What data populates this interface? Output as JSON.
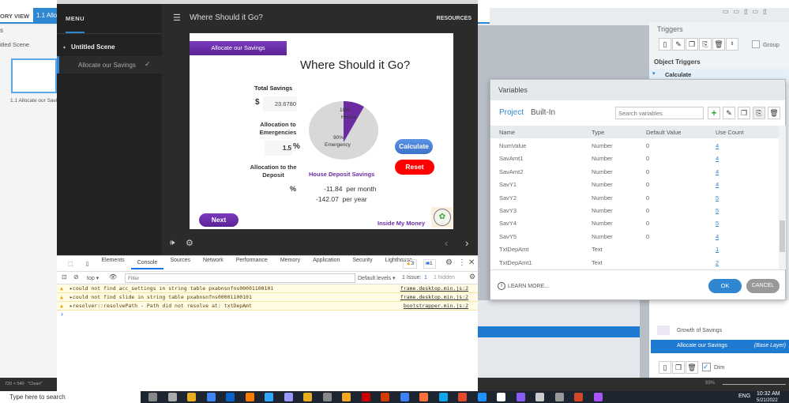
{
  "storyline": {
    "story_view": "ORY VIEW",
    "slide_tab": "1.1 Allo",
    "panel_s": "s",
    "scene_name": "itled Scene",
    "thumb_label": "1.1 Allocate our Savin",
    "dimensions": "720 × 540",
    "status_clean": "\"Clean\"",
    "triggers_title": "Triggers",
    "group_label": "Group",
    "object_triggers": "Object Triggers",
    "calculate_trigger": "Calculate",
    "layers": [
      {
        "label": "Growth of Savings"
      },
      {
        "label": "Allocate our Savings",
        "badge": "(Base Layer)"
      }
    ],
    "dim_label": "Dim",
    "zoom": "89%"
  },
  "player": {
    "menu_label": "MENU",
    "resources_label": "RESOURCES",
    "title": "Where Should it Go?",
    "scene": "Untitled Scene",
    "menu_item": "Allocate our Savings"
  },
  "slide": {
    "tag": "Allocate our Savings",
    "heading": "Where Should it Go?",
    "total_savings_label": "Total Savings",
    "currency": "$",
    "total_savings_value": "23.6780",
    "alloc_emerg_label": "Allocation to Emergencies",
    "alloc_emerg_value": "1.5",
    "pct": "%",
    "alloc_dep_label": "Allocation to the Deposit",
    "dep_pct": "%",
    "pie": {
      "house_pct": "10%",
      "house_label": "House",
      "emerg_pct": "90%",
      "emerg_label": "Emergency",
      "house_fraction": 0.1
    },
    "calculate": "Calculate",
    "reset": "Reset",
    "house_deposit_title": "House Deposit Savings",
    "per_month_value": "-11.84",
    "per_month": "per month",
    "per_year_value": "-142.07",
    "per_year": "per year",
    "next": "Next",
    "brand": "Inside My Money"
  },
  "devtools": {
    "tabs": [
      "Elements",
      "Console",
      "Sources",
      "Network",
      "Performance",
      "Memory",
      "Application",
      "Security",
      "Lighthouse"
    ],
    "active_tab": "Console",
    "more": "»",
    "warn_count": "3",
    "info_count": "1",
    "context": "top ▾",
    "filter_placeholder": "Filter",
    "levels": "Default levels ▾",
    "issues_label": "1 Issue:",
    "issues_count": "1",
    "hidden": "1 hidden",
    "messages": [
      {
        "text": "▸could not find acc_settings in string table pxabnsnfns00001100101",
        "src": "frame.desktop.min.js:2"
      },
      {
        "text": "▸could not find slide in string table pxabnsnfns00001100101",
        "src": "frame.desktop.min.js:2"
      },
      {
        "text": "▸resolver::resolvePath - Path did not resolve at: txtDepAmt",
        "src": "bootstrapper.min.js:2"
      }
    ],
    "prompt": "›"
  },
  "variables": {
    "title": "Variables",
    "tabs": [
      "Project",
      "Built-In"
    ],
    "search_placeholder": "Search variables",
    "columns": [
      "Name",
      "Type",
      "Default Value",
      "Use Count"
    ],
    "rows": [
      [
        "NumValue",
        "Number",
        "0",
        "4"
      ],
      [
        "SavAmt1",
        "Number",
        "0",
        "4"
      ],
      [
        "SavAmt2",
        "Number",
        "0",
        "4"
      ],
      [
        "SavY1",
        "Number",
        "0",
        "4"
      ],
      [
        "SavY2",
        "Number",
        "0",
        "5"
      ],
      [
        "SavY3",
        "Number",
        "0",
        "5"
      ],
      [
        "SavY4",
        "Number",
        "0",
        "5"
      ],
      [
        "SavY5",
        "Number",
        "0",
        "4"
      ],
      [
        "TxtDepAmt",
        "Text",
        "",
        "1"
      ],
      [
        "TxtDepAmt1",
        "Text",
        "",
        "2"
      ]
    ],
    "learn_more": "LEARN MORE...",
    "ok": "OK",
    "cancel": "CANCEL"
  },
  "taskbar": {
    "search_placeholder": "Type here to search",
    "lang": "ENG",
    "time": "10:32 AM",
    "date": "5/21/2022"
  },
  "colors": {
    "purple": "#6a2ca0",
    "blue_button": "#3f7fd9",
    "red_button": "#ff0000",
    "accent": "#2f86d1"
  }
}
